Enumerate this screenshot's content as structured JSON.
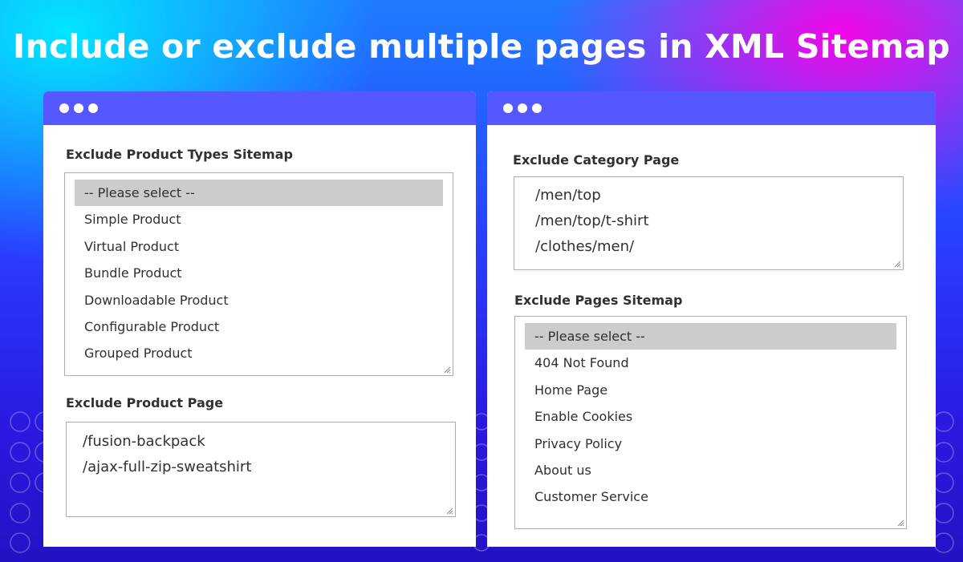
{
  "headline": "Include or exclude multiple pages in XML Sitemap",
  "colors": {
    "titlebar": "#5558ff",
    "selected_option": "#cccccc",
    "text": "#303030"
  },
  "left_window": {
    "product_types": {
      "label": "Exclude Product Types Sitemap",
      "options": [
        "-- Please select --",
        "Simple Product",
        "Virtual Product",
        "Bundle Product",
        "Downloadable Product",
        "Configurable Product",
        "Grouped Product"
      ],
      "selected": "-- Please select --"
    },
    "product_page": {
      "label": "Exclude Product Page",
      "lines": [
        "/fusion-backpack",
        "/ajax-full-zip-sweatshirt"
      ]
    }
  },
  "right_window": {
    "category_page": {
      "label": "Exclude Category Page",
      "lines": [
        "/men/top",
        "/men/top/t-shirt",
        "/clothes/men/"
      ]
    },
    "pages_sitemap": {
      "label": "Exclude Pages Sitemap",
      "options": [
        "-- Please select --",
        "404 Not Found",
        "Home Page",
        "Enable Cookies",
        "Privacy Policy",
        "About us",
        "Customer Service"
      ],
      "selected": "-- Please select --"
    }
  }
}
